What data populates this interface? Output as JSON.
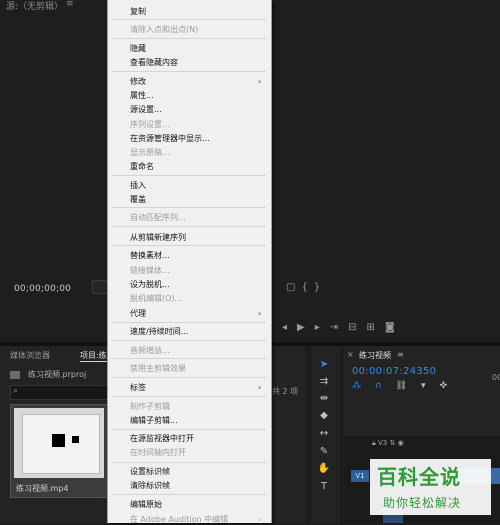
{
  "source_monitor": {
    "title": "源:（无剪辑）",
    "title_menu": "≡",
    "timecode": "00;00;00;00",
    "transport_icons": [
      "mark-in-icon",
      "mark-out-icon",
      "go-to-in-icon",
      "step-back-icon",
      "play-icon",
      "step-forward-icon",
      "go-to-out-icon",
      "insert-icon",
      "overwrite-icon",
      "export-frame-icon"
    ],
    "right_icons": [
      "square",
      "brace-left",
      "brace-right"
    ]
  },
  "context_menu": {
    "items": [
      {
        "label": "复制",
        "disabled": false
      },
      {
        "label": "清除入点和出点(N)",
        "disabled": true
      },
      {
        "label": "隐藏",
        "disabled": false
      },
      {
        "label": "查看隐藏内容",
        "disabled": false
      },
      {
        "label": "修改",
        "disabled": false,
        "submenu": true
      },
      {
        "label": "属性...",
        "disabled": false
      },
      {
        "label": "源设置...",
        "disabled": false
      },
      {
        "label": "序列设置...",
        "disabled": true
      },
      {
        "label": "在资源管理器中显示...",
        "disabled": false
      },
      {
        "label": "显示原稿...",
        "disabled": true
      },
      {
        "label": "重命名",
        "disabled": false
      },
      {
        "label": "插入",
        "disabled": false
      },
      {
        "label": "覆盖",
        "disabled": false
      },
      {
        "label": "自动匹配序列...",
        "disabled": true
      },
      {
        "label": "从剪辑新建序列",
        "disabled": false
      },
      {
        "label": "替换素材...",
        "disabled": false
      },
      {
        "label": "链接媒体...",
        "disabled": true
      },
      {
        "label": "设为脱机...",
        "disabled": false
      },
      {
        "label": "脱机编辑(O)...",
        "disabled": true
      },
      {
        "label": "代理",
        "disabled": false,
        "submenu": true
      },
      {
        "label": "速度/持续时间...",
        "disabled": false
      },
      {
        "label": "音频增益...",
        "disabled": true
      },
      {
        "label": "禁用主剪辑效果",
        "disabled": true
      },
      {
        "label": "标签",
        "disabled": false,
        "submenu": true
      },
      {
        "label": "制作子剪辑",
        "disabled": true
      },
      {
        "label": "编辑子剪辑...",
        "disabled": false
      },
      {
        "label": "在源监视器中打开",
        "disabled": false
      },
      {
        "label": "在时间轴内打开",
        "disabled": true
      },
      {
        "label": "设置标识帧",
        "disabled": false
      },
      {
        "label": "清除标识帧",
        "disabled": false
      },
      {
        "label": "编辑原始",
        "disabled": false
      },
      {
        "label": "在 Adobe Audition 中编辑",
        "disabled": true,
        "submenu": true
      }
    ],
    "submenu_arrow": "›"
  },
  "project_panel": {
    "tab_media_browser": "媒体浏览器",
    "tab_project": "项目:练",
    "project_filename": "练习视频.prproj",
    "search_placeholder": "",
    "items_count": "共 2 项",
    "clip_label": "练习视频.mp4"
  },
  "timeline": {
    "close": "×",
    "title": "练习视频",
    "menu": "≡",
    "timecode": "00:00:07:24350",
    "ruler_number": "00",
    "track_v3": "V3",
    "track_v1": "V1"
  },
  "watermark": {
    "title": "百科全说",
    "subtitle": "助你轻松解决"
  }
}
